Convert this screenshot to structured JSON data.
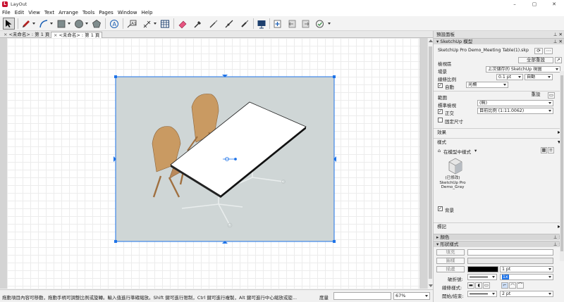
{
  "app": {
    "title": "LayOut",
    "icon_letter": "L"
  },
  "window_controls": [
    "–",
    "▢",
    "✕"
  ],
  "menu": [
    "File",
    "Edit",
    "View",
    "Text",
    "Arrange",
    "Tools",
    "Pages",
    "Window",
    "Help"
  ],
  "tabs": [
    {
      "label": "<未命名> : 第 1 頁",
      "active": false
    },
    {
      "label": "<未命名> : 第 1 頁",
      "active": true
    }
  ],
  "toolbar_icons": [
    "select-tool",
    "line-tool",
    "arc-tool",
    "rectangle-tool",
    "circle-tool",
    "polygon-tool",
    "text-tool",
    "label-tool",
    "dimension-tool",
    "table-tool",
    "eraser-tool",
    "style-tool",
    "split-tool",
    "join-tool",
    "presentation",
    "add-page",
    "previous-page",
    "next-page",
    "screen-text-scale"
  ],
  "status": {
    "hint": "拖動項目內容可移動，拖動手柄可調整比例或旋轉。輸入值進行準確縮放。Shift 鍵可進行限制，Ctrl 鍵可進行複製，Alt 鍵可進行中心縮放或旋...",
    "measure_label": "度量",
    "zoom": "67%"
  },
  "panel": {
    "title": "預設面板",
    "sketchup_model": {
      "header": "SketchUp 模型",
      "filename": "SketchUp Pro Demo_Meeting Table(1).skp",
      "reset_all": "全部重設",
      "view_label": "檢視區",
      "scene_label": "場景",
      "scene_value": "上次儲存的 SketchUp 視圖",
      "line_scale_label": "線條比例",
      "line_scale_value": "0.1 pt",
      "line_scale_mode": "自動",
      "auto_label": "自動",
      "auto_value": "光柵",
      "range_label": "範圍",
      "reset": "重設",
      "standard_view_label": "標準檢視",
      "standard_view_value": "(無)",
      "ortho_label": "正交",
      "ortho_value": "目前比例 (1:11.0062)",
      "fixed_size_label": "固定尺寸"
    },
    "effects_label": "效果",
    "styles": {
      "header": "樣式",
      "in_model_label": "在模型中樣式",
      "style_name": "(已修改) SketchUp Pro Demo_Gray",
      "background_label": "背景"
    },
    "tags_label": "標記",
    "color_header": "顏色",
    "shape_style": {
      "header": "形狀樣式",
      "fill_label": "填充",
      "pattern_label": "圖樣",
      "stroke_label": "描邊",
      "stroke_width": "1 pt",
      "dash_label": "破折號:",
      "dash_scale": "1x",
      "line_style_label": "線條樣式:",
      "start_label": "開始/結束:",
      "start_size": "2 pt"
    },
    "colors": {
      "stroke": "#000000",
      "accent": "#1e73e8"
    }
  }
}
